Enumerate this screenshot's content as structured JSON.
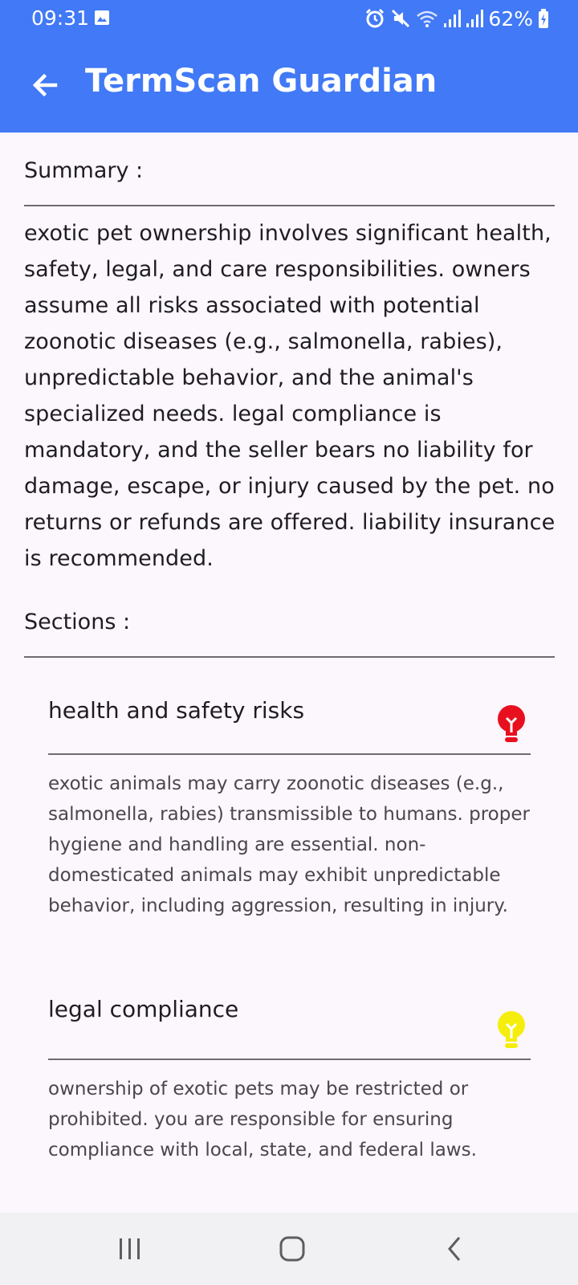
{
  "status_bar": {
    "time": "09:31",
    "battery": "62%",
    "icons": [
      "photo-icon",
      "alarm-icon",
      "mute-icon",
      "wifi-icon",
      "signal-icon",
      "signal-icon",
      "battery-charging-icon"
    ]
  },
  "header": {
    "title": "TermScan Guardian",
    "back_icon": "arrow-left-icon",
    "background_color": "#4179f6"
  },
  "summary": {
    "heading": "Summary :",
    "text": "exotic pet ownership involves significant health, safety, legal, and care responsibilities. owners assume all risks associated with potential zoonotic diseases (e.g., salmonella, rabies), unpredictable behavior, and the animal's specialized needs. legal compliance is mandatory, and the seller bears no liability for damage, escape, or injury caused by the pet. no returns or refunds are offered. liability insurance is recommended."
  },
  "sections": {
    "heading": "Sections :",
    "items": [
      {
        "title": "health and safety risks",
        "body": "exotic animals may carry zoonotic diseases (e.g., salmonella, rabies) transmissible to humans. proper hygiene and handling are essential. non-domesticated animals may exhibit unpredictable behavior, including aggression, resulting in injury.",
        "icon": "lightbulb-icon",
        "icon_color": "#e8101e"
      },
      {
        "title": "legal compliance",
        "body": "ownership of exotic pets may be restricted or prohibited.  you are responsible for ensuring compliance with local, state, and federal laws.",
        "icon": "lightbulb-icon",
        "icon_color": "#f5ee0c"
      }
    ]
  },
  "nav_bar": {
    "buttons": [
      "recent-apps-icon",
      "home-icon",
      "back-icon"
    ]
  }
}
